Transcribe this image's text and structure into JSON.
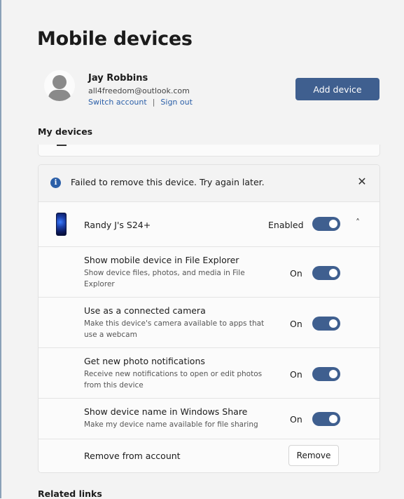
{
  "page": {
    "title": "Mobile devices"
  },
  "account": {
    "name": "Jay Robbins",
    "email": "all4freedom@outlook.com",
    "switch_label": "Switch account",
    "separator": "|",
    "signout_label": "Sign out"
  },
  "add_device_label": "Add device",
  "my_devices_title": "My devices",
  "info_bar": {
    "message": "Failed to remove this device. Try again later.",
    "close_glyph": "✕"
  },
  "device": {
    "name": "Randy J's S24+",
    "status_label": "Enabled",
    "enabled": true,
    "expand_glyph": "˄"
  },
  "settings": [
    {
      "title": "Show mobile device in File Explorer",
      "description": "Show device files, photos, and media in File Explorer",
      "state_label": "On",
      "on": true
    },
    {
      "title": "Use as a connected camera",
      "description": "Make this device's camera available to apps that use a webcam",
      "state_label": "On",
      "on": true
    },
    {
      "title": "Get new photo notifications",
      "description": "Receive new notifications to open or edit photos from this device",
      "state_label": "On",
      "on": true
    },
    {
      "title": "Show device name in Windows Share",
      "description": "Make my device name available for file sharing",
      "state_label": "On",
      "on": true
    }
  ],
  "remove_row": {
    "label": "Remove from account",
    "button_label": "Remove"
  },
  "related_links_title": "Related links",
  "colors": {
    "accent": "#3f5f8f",
    "link": "#2b5fa8",
    "background": "#f3f3f3"
  }
}
